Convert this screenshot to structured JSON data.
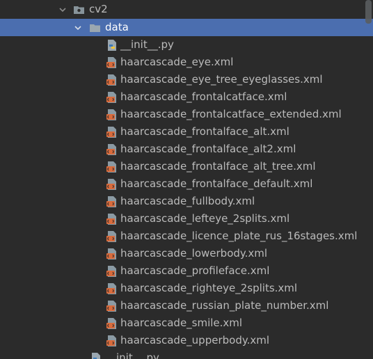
{
  "tree": {
    "cv2_folder": {
      "label": "cv2",
      "icon": "package-folder-icon",
      "expanded": true
    },
    "data_folder": {
      "label": "data",
      "icon": "folder-icon",
      "expanded": true,
      "selected": true
    },
    "data_files": [
      {
        "label": "__init__.py",
        "icon": "python-file-icon"
      },
      {
        "label": "haarcascade_eye.xml",
        "icon": "xml-file-icon"
      },
      {
        "label": "haarcascade_eye_tree_eyeglasses.xml",
        "icon": "xml-file-icon"
      },
      {
        "label": "haarcascade_frontalcatface.xml",
        "icon": "xml-file-icon"
      },
      {
        "label": "haarcascade_frontalcatface_extended.xml",
        "icon": "xml-file-icon"
      },
      {
        "label": "haarcascade_frontalface_alt.xml",
        "icon": "xml-file-icon"
      },
      {
        "label": "haarcascade_frontalface_alt2.xml",
        "icon": "xml-file-icon"
      },
      {
        "label": "haarcascade_frontalface_alt_tree.xml",
        "icon": "xml-file-icon"
      },
      {
        "label": "haarcascade_frontalface_default.xml",
        "icon": "xml-file-icon"
      },
      {
        "label": "haarcascade_fullbody.xml",
        "icon": "xml-file-icon"
      },
      {
        "label": "haarcascade_lefteye_2splits.xml",
        "icon": "xml-file-icon"
      },
      {
        "label": "haarcascade_licence_plate_rus_16stages.xml",
        "icon": "xml-file-icon"
      },
      {
        "label": "haarcascade_lowerbody.xml",
        "icon": "xml-file-icon"
      },
      {
        "label": "haarcascade_profileface.xml",
        "icon": "xml-file-icon"
      },
      {
        "label": "haarcascade_righteye_2splits.xml",
        "icon": "xml-file-icon"
      },
      {
        "label": "haarcascade_russian_plate_number.xml",
        "icon": "xml-file-icon"
      },
      {
        "label": "haarcascade_smile.xml",
        "icon": "xml-file-icon"
      },
      {
        "label": "haarcascade_upperbody.xml",
        "icon": "xml-file-icon"
      }
    ],
    "cv2_init": {
      "label": "__init__.py",
      "icon": "python-file-icon"
    }
  },
  "colors": {
    "background": "#2b2b2b",
    "selection": "#4b6eaf",
    "text": "#bbbbbb",
    "folder": "#87939a",
    "xml_icon": "#d96b3c",
    "python_blue": "#3d7ab8",
    "python_yellow": "#f0c53a"
  }
}
